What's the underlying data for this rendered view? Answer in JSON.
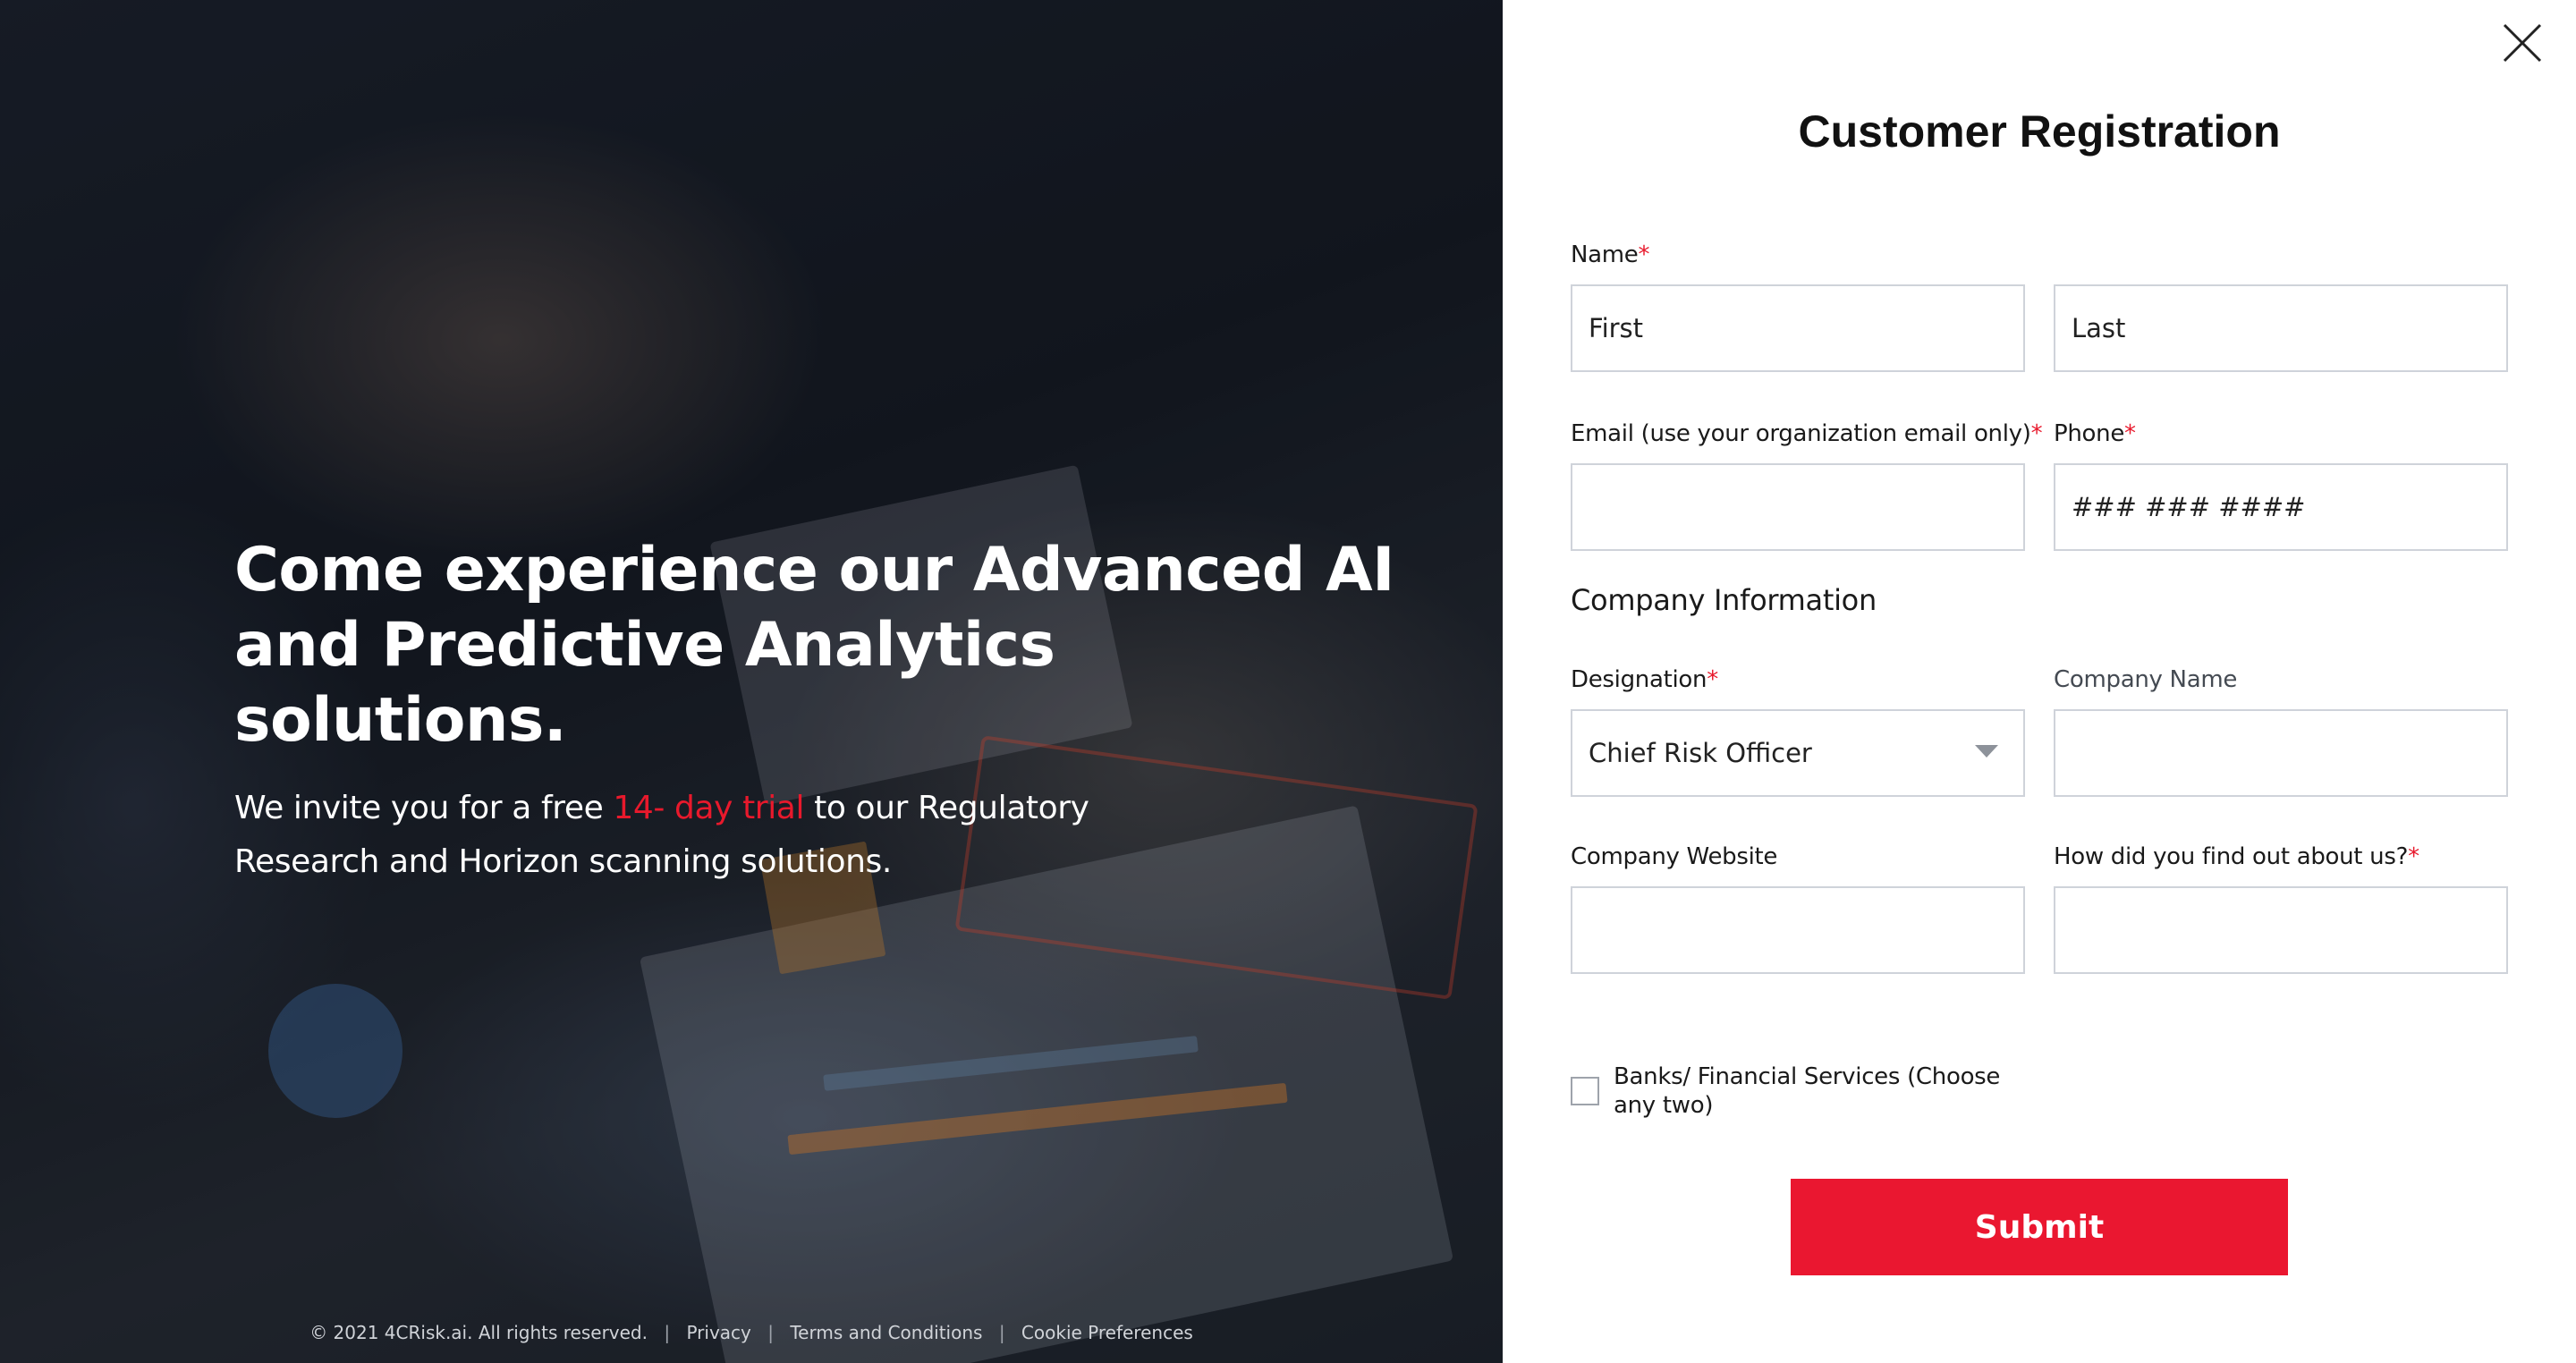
{
  "hero": {
    "headline_line1": "Come experience our Advanced AI",
    "headline_line2": "and Predictive Analytics solutions.",
    "sub_before": "We invite you for a free ",
    "sub_accent": "14- day trial",
    "sub_after": " to our Regulatory Research and Horizon scanning solutions.",
    "accent_color": "#e8192c"
  },
  "footer": {
    "copyright": "© 2021 4CRisk.ai. All rights reserved.",
    "separator": "|",
    "links": [
      "Privacy",
      "Terms and Conditions",
      "Cookie Preferences"
    ]
  },
  "form": {
    "title": "Customer Registration",
    "required_mark": "*",
    "name_label": "Name",
    "first_placeholder": "First",
    "last_placeholder": "Last",
    "email_label": "Email (use your organization email only)",
    "email_value": "",
    "phone_label": "Phone",
    "phone_placeholder": "### ### ####",
    "section_company": "Company Information",
    "designation_label": "Designation",
    "designation_selected": "Chief Risk Officer",
    "company_name_label": "Company Name",
    "company_name_value": "",
    "company_website_label": "Company Website",
    "company_website_value": "",
    "find_out_label": "How did you find out about us?",
    "find_out_value": "",
    "checkbox_label": "Banks/ Financial Services (Choose any two)",
    "submit_label": "Submit",
    "submit_color": "#ea1730"
  },
  "icons": {
    "close": "close-icon",
    "dropdown": "chevron-down-icon",
    "checkbox": "checkbox-icon"
  }
}
